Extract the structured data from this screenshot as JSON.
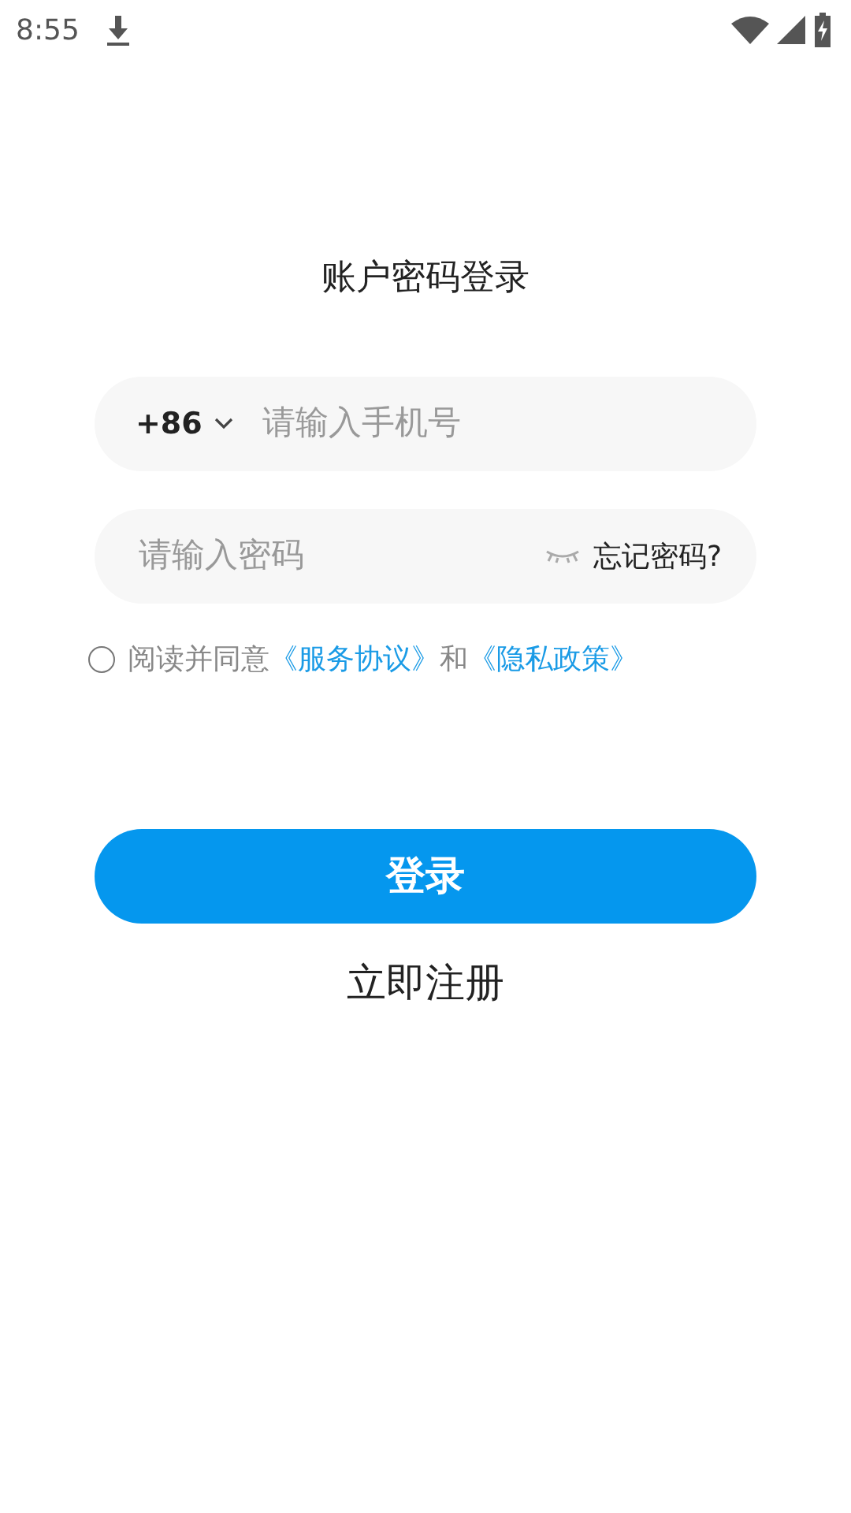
{
  "status_bar": {
    "time": "8:55"
  },
  "title": "账户密码登录",
  "phone_field": {
    "country_code": "+86",
    "placeholder": "请输入手机号"
  },
  "password_field": {
    "placeholder": "请输入密码",
    "password_visible": false,
    "forgot_link": "忘记密码?"
  },
  "agreement": {
    "checked": false,
    "text": "阅读并同意",
    "terms_link": "《服务协议》",
    "joiner": "和",
    "privacy_link": "《隐私政策》"
  },
  "login_button": "登录",
  "register_link": "立即注册"
}
